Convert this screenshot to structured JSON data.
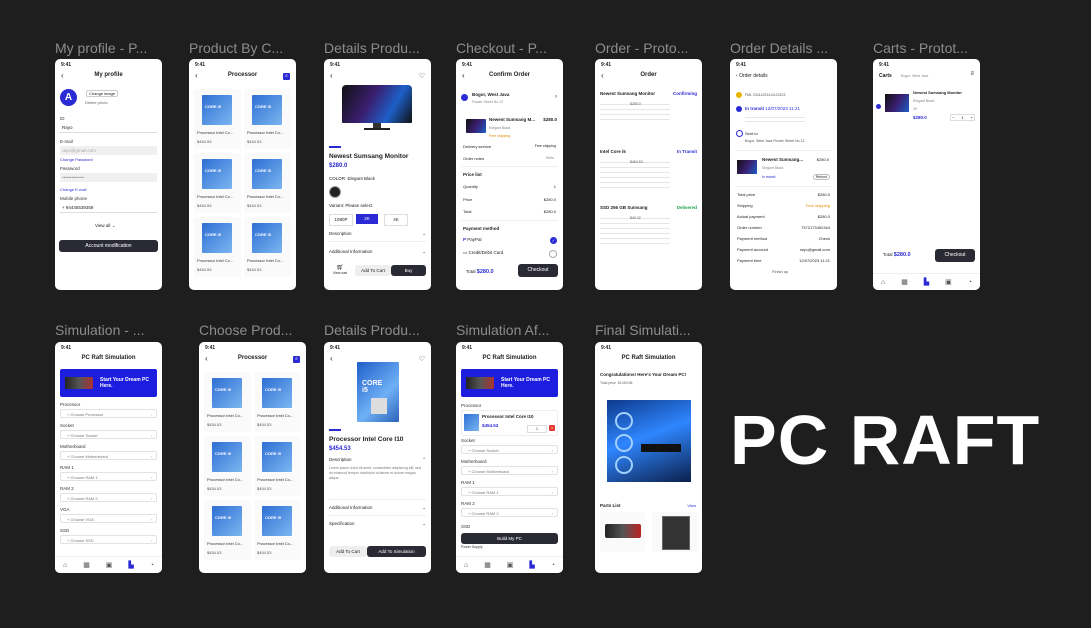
{
  "brand": "PC RAFT",
  "frames": [
    {
      "title": "My profile - P..."
    },
    {
      "title": "Product By C..."
    },
    {
      "title": "Details Produ..."
    },
    {
      "title": "Checkout - P..."
    },
    {
      "title": "Order - Proto..."
    },
    {
      "title": "Order Details ..."
    },
    {
      "title": "Carts - Protot..."
    },
    {
      "title": "Simulation - ..."
    },
    {
      "title": "Choose Prod..."
    },
    {
      "title": "Details Produ..."
    },
    {
      "title": "Simulation Af..."
    },
    {
      "title": "Final Simulati..."
    }
  ],
  "status_time": "9:41",
  "icons": [
    "back-arrow-icon",
    "search-icon",
    "heart-icon",
    "home-icon",
    "grid-icon",
    "cart-icon",
    "pc-icon",
    "user-icon",
    "check-icon",
    "chevron-right-icon",
    "chevron-down-icon"
  ],
  "accent": "#2b2bd6",
  "dark_button": "#2a2a35",
  "profile": {
    "header": "My profile",
    "avatar_letter": "A",
    "change_image": "Change image",
    "delete": "Delete photo",
    "id_label": "ID",
    "id_value": "Rayo",
    "email_label": "E-mail",
    "email_value": "rayo@gmail.com",
    "change_password_link": "Change Password",
    "password_label": "Password",
    "password_value": "••••••••••••••",
    "change_email_link": "Change E-mail",
    "phone_label": "Mobile phone",
    "phone_value": "+ 94445539359",
    "view_all": "View all",
    "button": "Account modification"
  },
  "product_list": {
    "header": "Processor",
    "items": [
      {
        "name": "Processor Intel Co...",
        "price": "$454.53"
      },
      {
        "name": "Processor Intel Co...",
        "price": "$454.53"
      },
      {
        "name": "Processor Intel Co...",
        "price": "$454.53"
      },
      {
        "name": "Processor Intel Co...",
        "price": "$454.53"
      },
      {
        "name": "Processor Intel Co...",
        "price": "$454.53"
      },
      {
        "name": "Processor Intel Co...",
        "price": "$454.53"
      }
    ]
  },
  "detail_monitor": {
    "title": "Newest Sumsang Monitor",
    "price": "$280.0",
    "color_label": "COLOR: Elegant Black",
    "variant_label": "Variant: Please select",
    "variants": [
      "1080P",
      "2K",
      "4K"
    ],
    "description": "Description",
    "additional": "Additional Information",
    "view_cart": "View cart",
    "add_to_cart": "Add To Cart",
    "buy": "Buy"
  },
  "checkout": {
    "header": "Confirm Order",
    "address_title": "Bogor, West Java",
    "address_sub": "Flower Street No.12",
    "item_name": "Newest Sumsang M...",
    "item_price": "$280.0",
    "item_variant": "Elegant Black",
    "free_shipping": "Free shipping",
    "delivery_label": "Delivery service",
    "delivery_value": "Free shipping",
    "notes_label": "Order notes",
    "notes_value": "Write",
    "price_list": "Price list",
    "quantity_label": "Quantity",
    "quantity_value": "1",
    "price_label": "Price",
    "price_value": "$280.0",
    "total_label": "Total",
    "total_value": "$280.0",
    "payment_method": "Payment method",
    "paypal": "PayPal",
    "card": "Credit/Debit Card",
    "footer_total_label": "Total",
    "footer_total": "$280.0",
    "checkout_button": "Checkout"
  },
  "orders": {
    "header": "Order",
    "list": [
      {
        "name": "Newest Sumsang Monitor",
        "status": "Confirming",
        "amount": "$280.0",
        "status_color": "#2b2bd6"
      },
      {
        "name": "Intel Core i5",
        "status": "In Transit",
        "amount": "$454.53",
        "status_color": "#2b2bd6"
      },
      {
        "name": "SSD 256 GB Sumsang",
        "status": "Delivered",
        "amount": "$40.32",
        "status_color": "#1aa34a"
      }
    ]
  },
  "order_details": {
    "header": "Order details",
    "tracking_no": "FML 23414231411123123",
    "transit_label": "In transit",
    "transit_date": "12/07/2023 11:21",
    "sent_to": "Sent to",
    "address": "Bogor, West Java Flower Street No.12",
    "item_name": "Newest Sumsang...",
    "item_price": "$280.0",
    "item_variant": "Elegant Black",
    "in_transit": "In transit",
    "refund": "Refund",
    "rows": [
      {
        "k": "Total price",
        "v": "$280.0"
      },
      {
        "k": "Shipping",
        "v": "Free shipping"
      },
      {
        "k": "Actual payment",
        "v": "$280.0"
      },
      {
        "k": "Order number",
        "v": "7372173452344"
      },
      {
        "k": "Payment method",
        "v": "Check"
      },
      {
        "k": "Payment account",
        "v": "rayo@gmail.com"
      },
      {
        "k": "Payment time",
        "v": "12/07/2023 11:21"
      }
    ],
    "finish": "Finish up"
  },
  "cart": {
    "header": "Carts",
    "address": "Bogor, West Java",
    "item_name": "Newest Sumsang Monitor",
    "item_variant": "Elegant Black",
    "item_size": "2K",
    "item_price": "$280.0",
    "qty": "1",
    "total_label": "Total",
    "total": "$280.0",
    "checkout": "Checkout"
  },
  "simulation": {
    "header": "PC Raft Simulation",
    "banner": "Start Your Dream PC Here.",
    "sections": [
      {
        "label": "Processor",
        "placeholder": "Choose Processor"
      },
      {
        "label": "Socket",
        "placeholder": "Choose Socket"
      },
      {
        "label": "Motherboard",
        "placeholder": "Choose Motherboard"
      },
      {
        "label": "RAM 1",
        "placeholder": "Choose RAM 1"
      },
      {
        "label": "RAM 2",
        "placeholder": "Choose RAM 2"
      },
      {
        "label": "VGA",
        "placeholder": "Choose VGA"
      },
      {
        "label": "SSD",
        "placeholder": "Choose SSD"
      }
    ]
  },
  "detail_cpu": {
    "title": "Processor Intel Core I10",
    "price": "$454.53",
    "description": "Description",
    "desc_text": "Lorem ipsum dolor sit amet, consectetur adipiscing elit, sed do eiusmod tempor incididunt ut labore et dolore magna aliqua.",
    "additional": "Additional Information",
    "specification": "Specification",
    "add_to_cart": "Add To Cart",
    "add_to_sim": "Add To Simulation"
  },
  "sim_after": {
    "header": "PC Raft Simulation",
    "banner": "Start Your Dream PC Here.",
    "processor_label": "Processor",
    "processor_name": "Processor Intel Core I10",
    "processor_price": "$454.53",
    "qty": "1",
    "sections": [
      {
        "label": "Socket",
        "placeholder": "Choose Socket"
      },
      {
        "label": "Motherboard",
        "placeholder": "Choose Motherboard"
      },
      {
        "label": "RAM 1",
        "placeholder": "Choose RAM 1"
      },
      {
        "label": "RAM 2",
        "placeholder": "Choose RAM 2"
      }
    ],
    "ssd_label": "SSD",
    "power_label": "Power Supply",
    "build": "Build My PC"
  },
  "final_sim": {
    "header": "PC Raft Simulation",
    "congrats": "Congratulations! Here's Your Dream PC!",
    "total_label": "Total price",
    "total_value": "$1454.56",
    "parts": "Parts List",
    "view": "View"
  }
}
